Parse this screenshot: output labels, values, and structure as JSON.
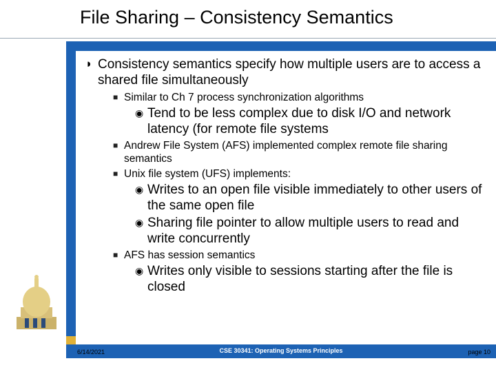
{
  "title": "File Sharing – Consistency Semantics",
  "body": {
    "p1_lead": "Consistency semantics",
    "p1_rest": " specify how multiple users are to access a shared file simultaneously",
    "s1": "Similar to Ch 7 process synchronization algorithms",
    "s1a": "Tend to be less complex due to disk I/O and network latency (for remote file systems",
    "s2": "Andrew File System (AFS) implemented complex remote file sharing semantics",
    "s3": "Unix file system (UFS) implements:",
    "s3a": "Writes to an open file visible immediately to other users of the same open file",
    "s3b": "Sharing file pointer to allow multiple users to read and write concurrently",
    "s4": "AFS has session semantics",
    "s4a": "Writes only visible to sessions starting after the file is closed"
  },
  "footer": {
    "date": "6/14/2021",
    "course": "CSE 30341: Operating Systems Principles",
    "page": "page 10"
  }
}
